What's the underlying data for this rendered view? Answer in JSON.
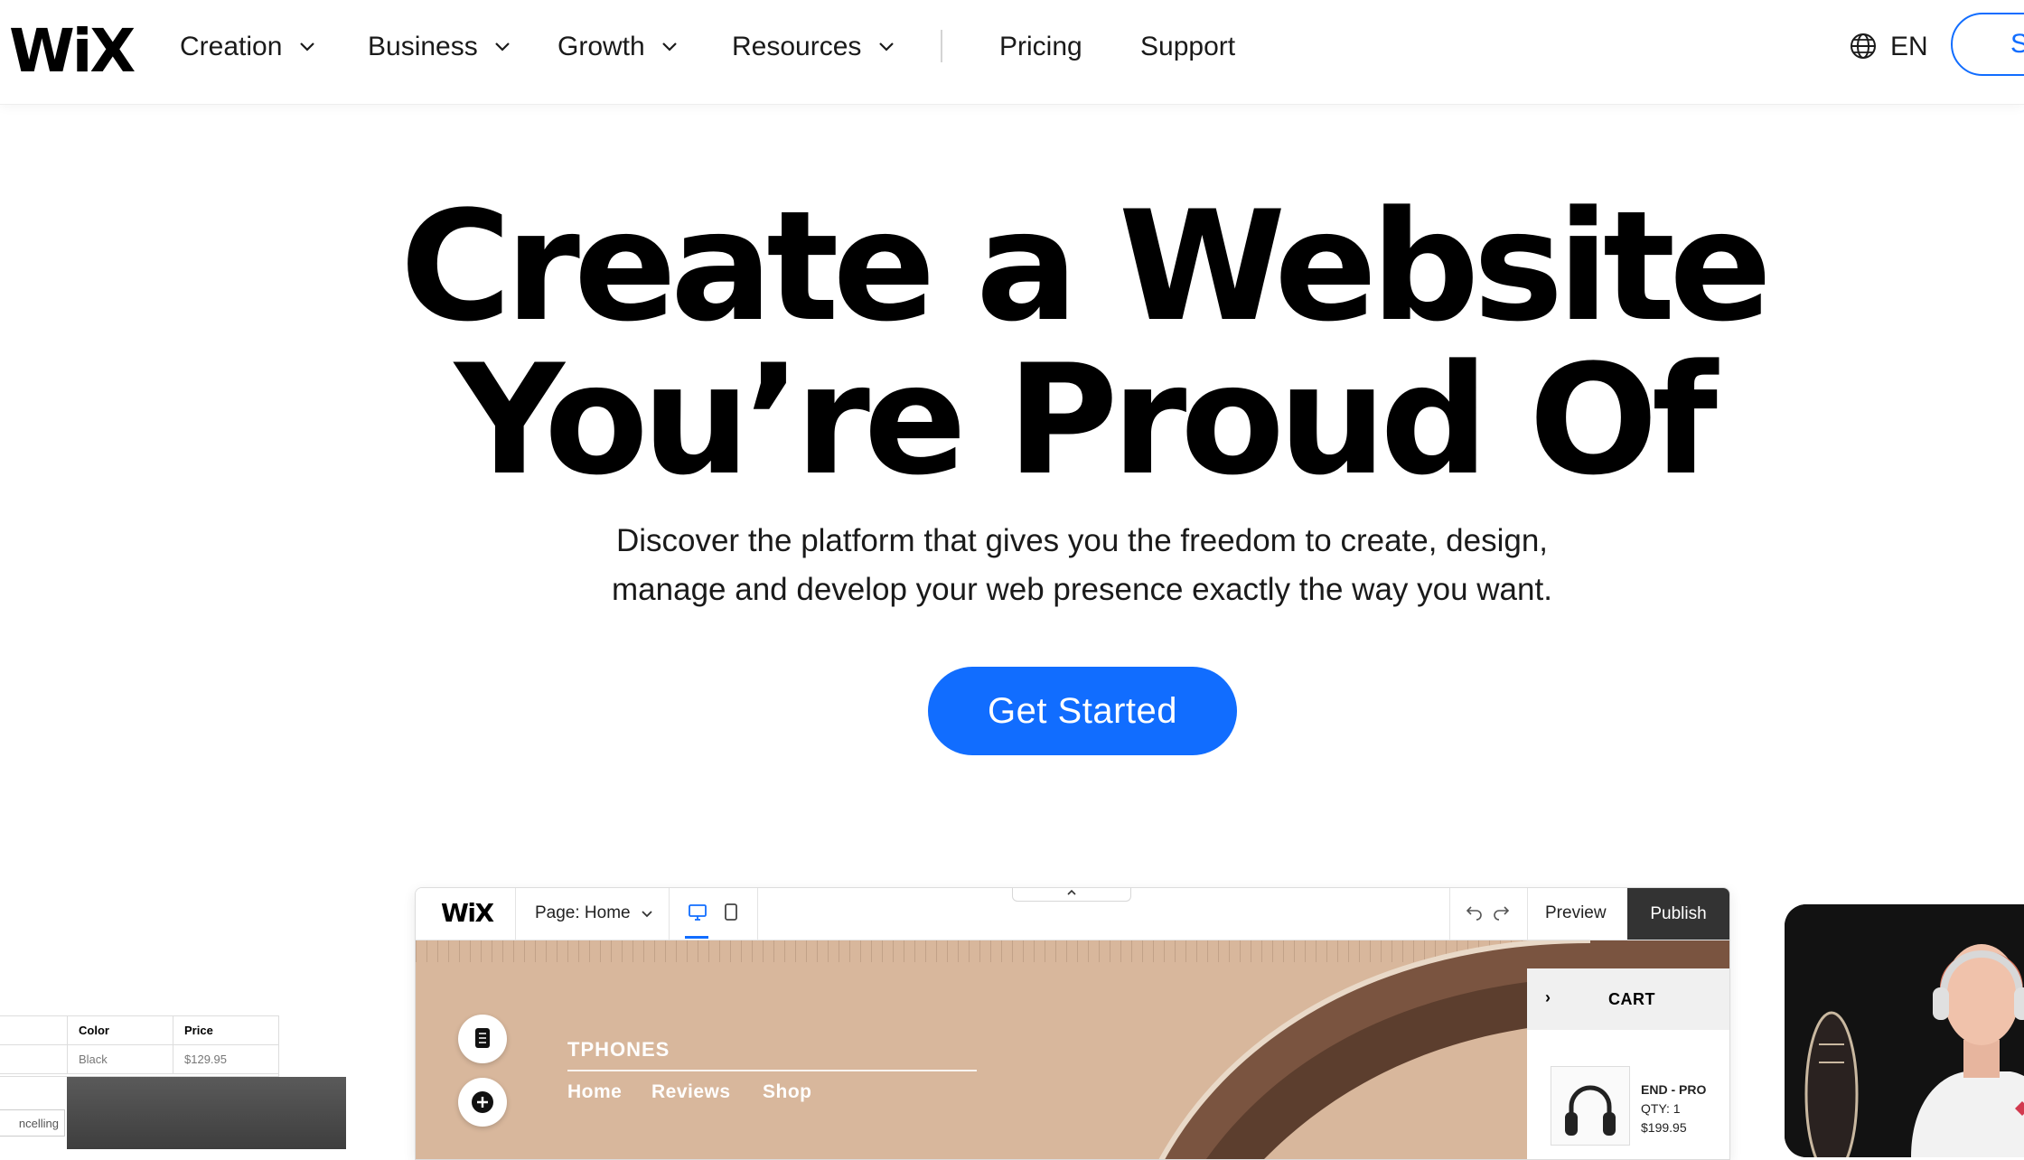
{
  "nav": {
    "logo": "WiX",
    "items": [
      {
        "label": "Creation"
      },
      {
        "label": "Business"
      },
      {
        "label": "Growth"
      },
      {
        "label": "Resources"
      }
    ],
    "links": [
      {
        "label": "Pricing"
      },
      {
        "label": "Support"
      }
    ],
    "language": "EN",
    "signin_label": "S"
  },
  "hero": {
    "title_line1": "Create a Website",
    "title_line2": "You’re Proud Of",
    "subtitle_line1": "Discover the platform that gives you the freedom to create, design,",
    "subtitle_line2": "manage and develop your web presence exactly the way you want.",
    "cta_label": "Get Started"
  },
  "editor": {
    "logo": "WiX",
    "page_selector": "Page: Home",
    "preview_label": "Preview",
    "publish_label": "Publish",
    "site": {
      "brand": "TPHONES",
      "nav": [
        "Home",
        "Reviews",
        "Shop"
      ]
    },
    "cart": {
      "title": "CART",
      "item_name": "END - PRO",
      "item_qty": "QTY: 1",
      "item_price": "$199.95"
    }
  },
  "product_table": {
    "headers": [
      "Color",
      "Price"
    ],
    "row": [
      "Black",
      "$129.95"
    ],
    "chip": "ncelling"
  },
  "colors": {
    "accent": "#116dff",
    "canvas": "#d8b79c",
    "publish_bg": "#333333"
  }
}
